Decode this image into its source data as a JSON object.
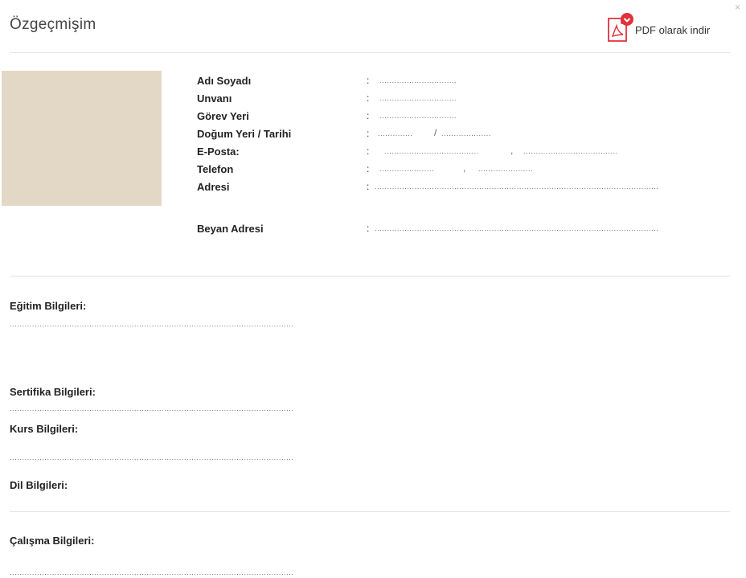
{
  "header": {
    "title": "Özgeçmişim",
    "pdf_label": "PDF olarak indir",
    "close_glyph": "×",
    "accent_color": "#e0313b"
  },
  "photo": {
    "color": "#e3d8c6"
  },
  "profile": {
    "colon": ":",
    "fields": [
      {
        "label": "Adı Soyadı",
        "value": "..............................."
      },
      {
        "label": "Unvanı",
        "value": "..............................."
      },
      {
        "label": "Görev Yeri",
        "value": "..............................."
      },
      {
        "label": "Doğum Yeri / Tarihi",
        "value_a": "..............",
        "sep": "/",
        "value_b": "...................."
      },
      {
        "label": "E-Posta:",
        "value_a": "......................................",
        "sep": ",",
        "value_b": "......................................"
      },
      {
        "label": "Telefon",
        "value_a": "......................",
        "sep": ",",
        "value_b": "......................"
      },
      {
        "label": "Adresi",
        "value": "........................................................................................................................"
      },
      {
        "label": "Beyan Adresi",
        "value": "........................................................................................................................"
      }
    ]
  },
  "sections": {
    "education": {
      "title": "Eğitim Bilgileri:",
      "value": "..........................................................................................................................."
    },
    "certificate": {
      "title": "Sertifika Bilgileri:",
      "value": "..........................................................................................................................."
    },
    "course": {
      "title": "Kurs Bilgileri:",
      "value": "..........................................................................................................................."
    },
    "language": {
      "title": "Dil Bilgileri:"
    },
    "work": {
      "title": "Çalışma Bilgileri:",
      "value": "..........................................................................................................................."
    }
  }
}
